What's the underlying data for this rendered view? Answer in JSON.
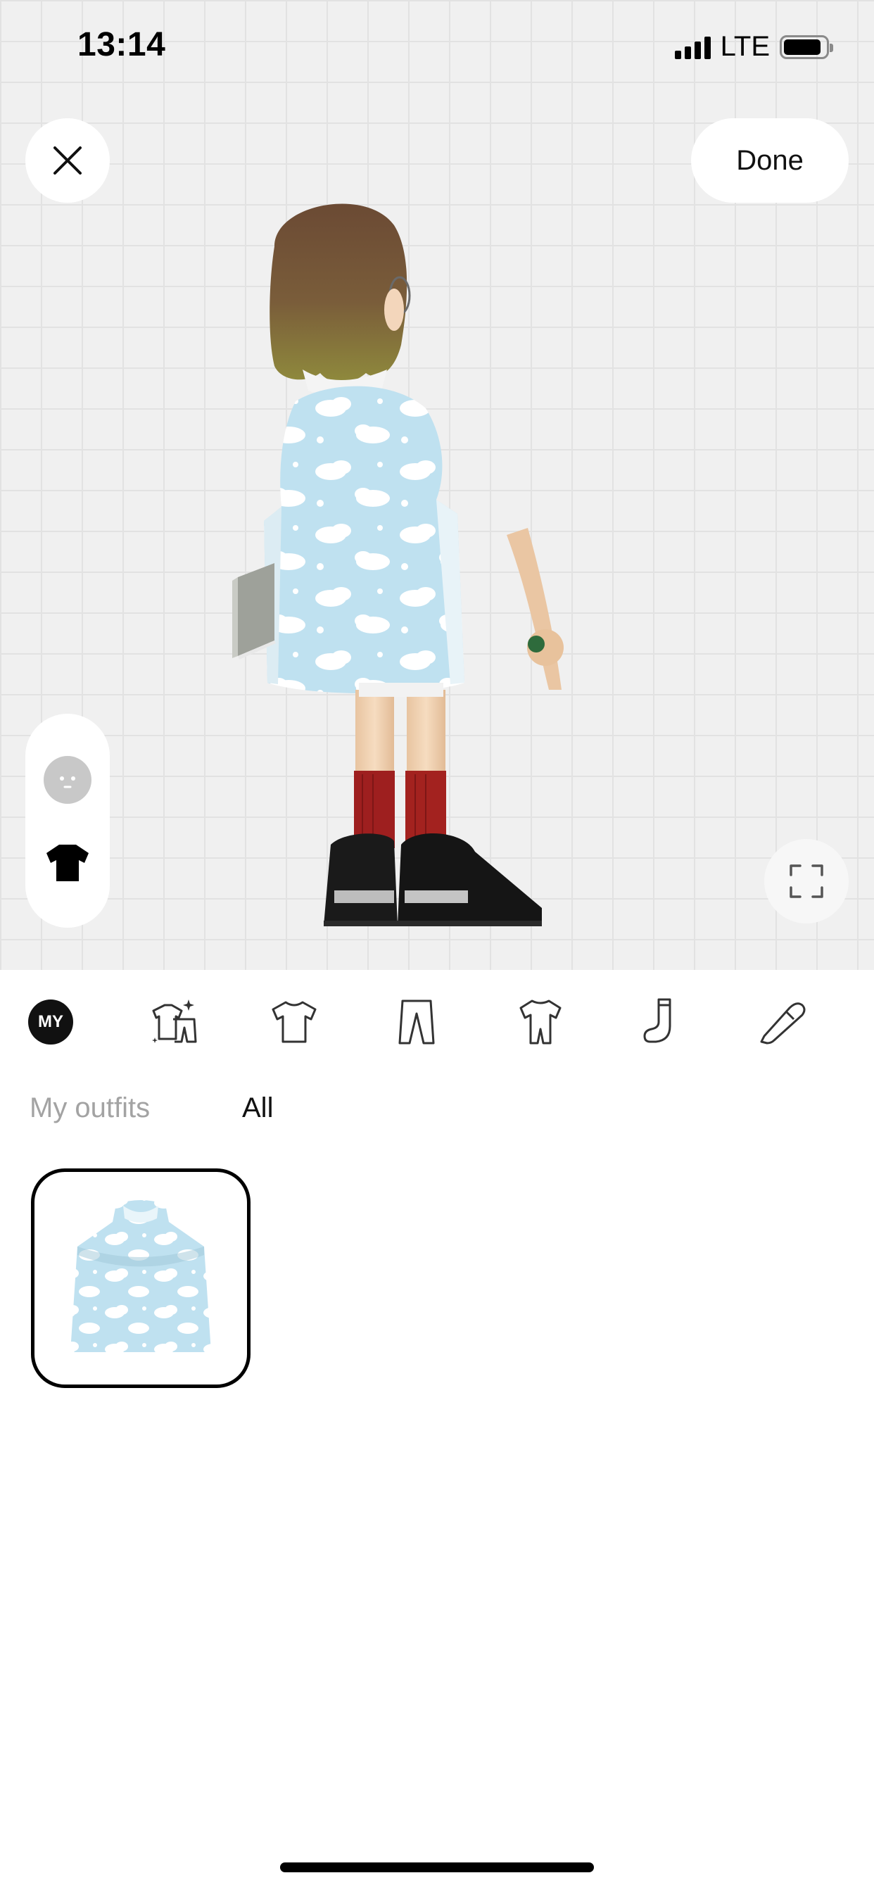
{
  "status_bar": {
    "time": "13:14",
    "network": "LTE",
    "battery_level": 0.85
  },
  "header": {
    "close_icon": "close-icon",
    "done_label": "Done"
  },
  "side_tools": [
    {
      "icon": "face-icon"
    },
    {
      "icon": "shirt-icon"
    }
  ],
  "fullscreen_icon": "fullscreen-icon",
  "categories": [
    {
      "label": "MY",
      "icon": "my-badge"
    },
    {
      "icon": "outfit-set-icon"
    },
    {
      "icon": "top-icon"
    },
    {
      "icon": "pants-icon"
    },
    {
      "icon": "onepiece-icon"
    },
    {
      "icon": "socks-icon"
    },
    {
      "icon": "shoe-icon"
    }
  ],
  "subtabs": [
    {
      "label": "My outfits",
      "selected": false
    },
    {
      "label": "All",
      "selected": true
    }
  ],
  "outfits": [
    {
      "name": "cloud-print-cape",
      "selected": true
    }
  ],
  "colors": {
    "grid_background": "#f0f0f0",
    "accent": "#111111",
    "muted_text": "#a3a3a3",
    "cloud_fabric": "#bfe1f0"
  }
}
